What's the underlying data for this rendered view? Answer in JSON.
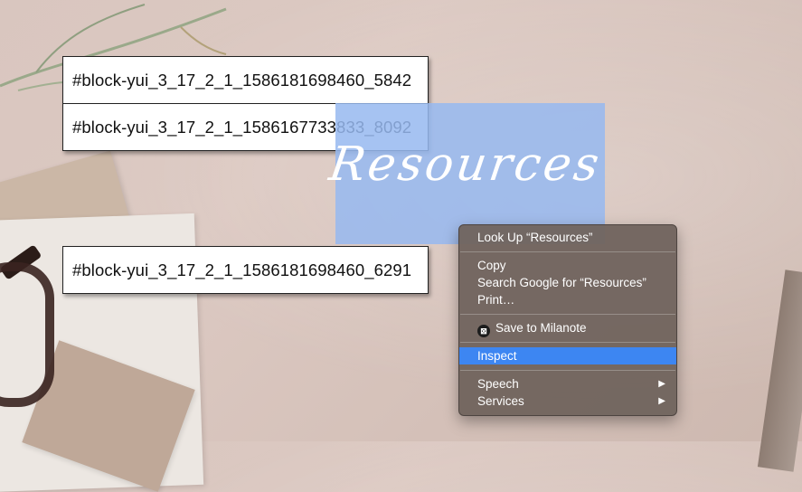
{
  "id_boxes": [
    "#block-yui_3_17_2_1_1586181698460_5842",
    "#block-yui_3_17_2_1_1586167733833_8092",
    "#block-yui_3_17_2_1_1586181698460_6291"
  ],
  "selection": {
    "script_text": "Resources",
    "highlight_color": "#96b9f0"
  },
  "context_menu": {
    "look_up": "Look Up “Resources”",
    "copy": "Copy",
    "search_google": "Search Google for “Resources”",
    "print": "Print…",
    "save_to_milanote": "Save to Milanote",
    "inspect": "Inspect",
    "speech": "Speech",
    "services": "Services",
    "active_color": "#3d86f2",
    "submenu_arrow": "▶"
  },
  "icons": {
    "milanote": "milanote-icon"
  }
}
